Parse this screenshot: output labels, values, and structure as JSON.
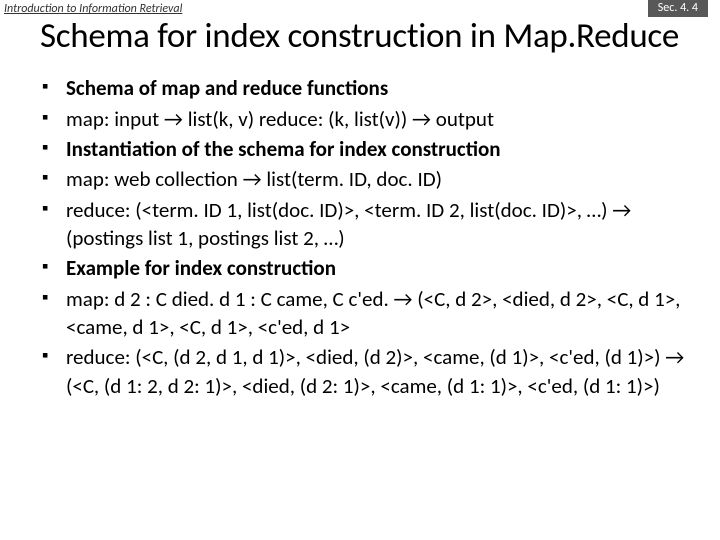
{
  "header": {
    "course": "Introduction to Information Retrieval",
    "section": "Sec. 4. 4"
  },
  "title": "Schema for index construction in Map.Reduce",
  "bullets": [
    {
      "text": "Schema of map and reduce functions",
      "bold": true
    },
    {
      "text": "map: input → list(k, v)     reduce: (k, list(v)) → output",
      "bold": false
    },
    {
      "text": "Instantiation of the schema for index construction",
      "bold": true
    },
    {
      "text": "map: web collection → list(term. ID, doc. ID)",
      "bold": false
    },
    {
      "text": "reduce: (<term. ID 1, list(doc. ID)>, <term. ID 2, list(doc. ID)>, …) → (postings list 1, postings list 2, …)",
      "bold": false
    },
    {
      "text": "Example for index construction",
      "bold": true
    },
    {
      "text": "map: d 2 : C died. d 1 : C came, C c'ed. → (<C, d 2>, <died, d 2>, <C, d 1>, <came, d 1>, <C, d 1>, <c'ed, d 1>",
      "bold": false
    },
    {
      "text": "reduce: (<C, (d 2, d 1, d 1)>, <died, (d 2)>, <came, (d 1)>, <c'ed, (d 1)>)  →  (<C, (d 1: 2, d 2: 1)>, <died, (d 2: 1)>, <came, (d 1: 1)>, <c'ed, (d 1: 1)>)",
      "bold": false
    }
  ]
}
